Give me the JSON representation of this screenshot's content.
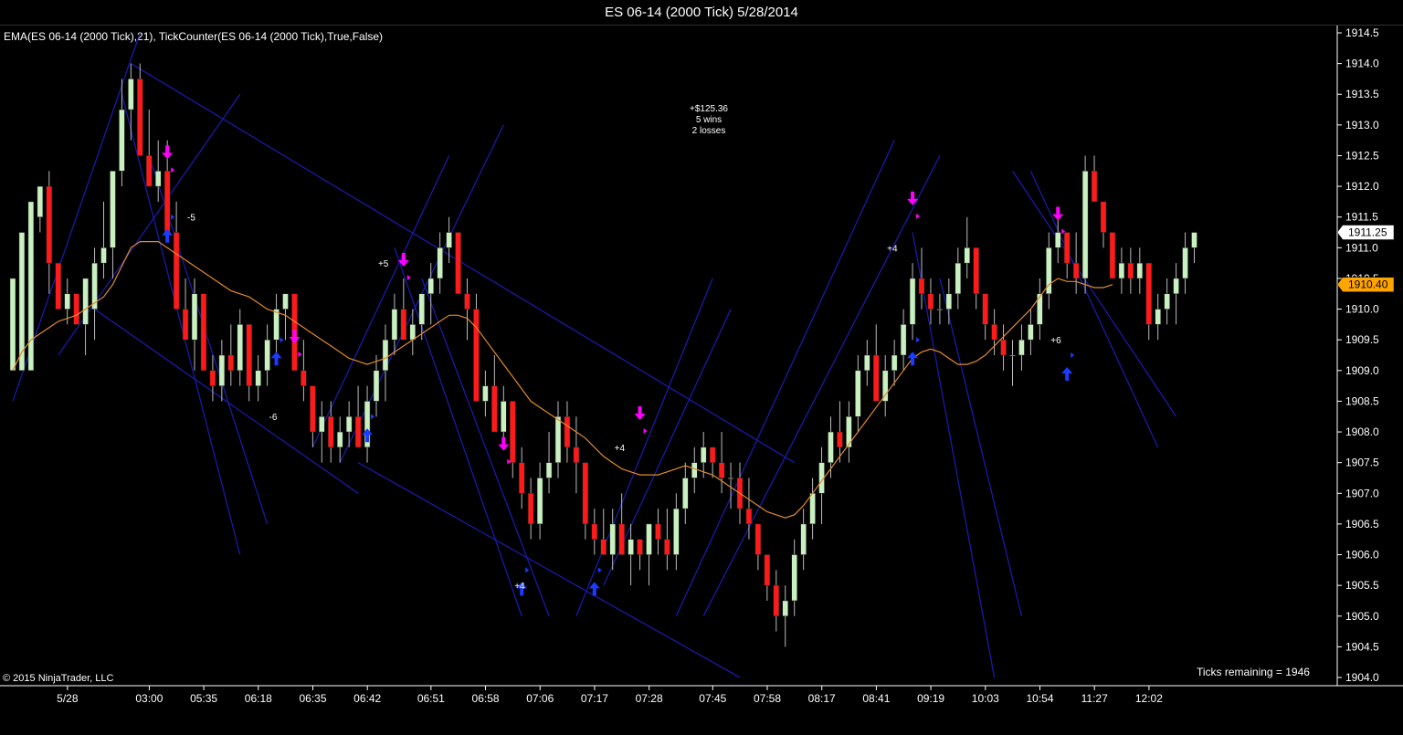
{
  "window": {
    "title": "ES 06-14 (2000 Tick)  5/28/2014"
  },
  "indicator_label": "EMA(ES 06-14 (2000 Tick),21),  TickCounter(ES 06-14 (2000 Tick),True,False)",
  "copyright": "© 2015 NinjaTrader, LLC",
  "ticks_remaining": "Ticks remaining = 1946",
  "strategy_stats": {
    "pnl": "+$125.36",
    "wins": "5 wins",
    "losses": "2 losses"
  },
  "colors": {
    "background": "#000000",
    "up_candle": "#c8f0c0",
    "down_candle": "#ff1a1a",
    "ema": "#e08a2a",
    "trendline": "#1a1aa8",
    "entry_short": "#ff00ff",
    "entry_long": "#1a3cff",
    "last_price_bg": "#ffffff",
    "ema_price_bg": "#ffa500"
  },
  "chart_data": {
    "type": "candlestick",
    "instrument": "ES 06-14",
    "bar_type": "2000 Tick",
    "ylim": [
      1904.0,
      1914.5
    ],
    "y_ticks": [
      "1904.0",
      "1904.5",
      "1905.0",
      "1905.5",
      "1906.0",
      "1906.5",
      "1907.0",
      "1907.5",
      "1908.0",
      "1908.5",
      "1909.0",
      "1909.5",
      "1910.0",
      "1910.5",
      "1911.0",
      "1911.5",
      "1912.0",
      "1912.5",
      "1913.0",
      "1913.5",
      "1914.0",
      "1914.5"
    ],
    "x_tick_labels": [
      "5/28",
      "03:00",
      "05:35",
      "06:18",
      "06:35",
      "06:42",
      "06:51",
      "06:58",
      "07:06",
      "07:17",
      "07:28",
      "07:45",
      "07:58",
      "08:17",
      "08:41",
      "09:19",
      "10:03",
      "10:54",
      "11:27",
      "12:02"
    ],
    "x_tick_bar_index": [
      3,
      12,
      18,
      24,
      30,
      36,
      43,
      49,
      55,
      61,
      67,
      74,
      80,
      86,
      92,
      98,
      104,
      110,
      116,
      122
    ],
    "last_price": "1911.25",
    "ema_price": "1910.40",
    "ohlc": [
      [
        1909.0,
        1910.5,
        1909.0,
        1910.5
      ],
      [
        1909.0,
        1909.0,
        1910.75,
        1911.25
      ],
      [
        1909.0,
        1909.0,
        1911.5,
        1911.75
      ],
      [
        1911.5,
        1911.75,
        1911.25,
        1912.0
      ],
      [
        1912.0,
        1912.25,
        1910.25,
        1910.75
      ],
      [
        1910.75,
        1910.75,
        1910.0,
        1910.0
      ],
      [
        1910.0,
        1910.5,
        1909.75,
        1910.25
      ],
      [
        1910.25,
        1910.25,
        1909.75,
        1909.75
      ],
      [
        1909.75,
        1910.5,
        1909.25,
        1910.5
      ],
      [
        1910.0,
        1911.0,
        1909.5,
        1910.75
      ],
      [
        1910.75,
        1911.75,
        1910.5,
        1911.0
      ],
      [
        1911.0,
        1912.25,
        1910.5,
        1912.25
      ],
      [
        1912.25,
        1913.75,
        1912.0,
        1913.25
      ],
      [
        1913.25,
        1914.0,
        1912.75,
        1913.75
      ],
      [
        1913.75,
        1914.0,
        1912.5,
        1912.5
      ],
      [
        1912.5,
        1913.25,
        1912.0,
        1912.0
      ],
      [
        1912.0,
        1912.75,
        1911.75,
        1912.25
      ],
      [
        1912.25,
        1912.75,
        1911.25,
        1911.25
      ],
      [
        1911.25,
        1911.75,
        1910.0,
        1910.0
      ],
      [
        1910.0,
        1910.5,
        1909.5,
        1909.5
      ],
      [
        1909.5,
        1910.5,
        1909.0,
        1910.25
      ],
      [
        1910.25,
        1910.25,
        1909.0,
        1909.0
      ],
      [
        1909.0,
        1909.25,
        1908.5,
        1908.75
      ],
      [
        1908.75,
        1909.5,
        1908.5,
        1909.25
      ],
      [
        1909.25,
        1909.75,
        1908.75,
        1909.0
      ],
      [
        1909.0,
        1910.0,
        1908.75,
        1909.75
      ],
      [
        1909.75,
        1909.75,
        1908.5,
        1908.75
      ],
      [
        1908.75,
        1909.25,
        1908.5,
        1909.0
      ],
      [
        1909.0,
        1909.75,
        1908.75,
        1909.5
      ],
      [
        1909.5,
        1910.25,
        1909.25,
        1910.0
      ],
      [
        1910.0,
        1910.25,
        1909.5,
        1910.25
      ],
      [
        1910.25,
        1910.25,
        1909.0,
        1909.0
      ],
      [
        1909.0,
        1909.5,
        1908.5,
        1908.75
      ],
      [
        1908.75,
        1908.75,
        1907.75,
        1908.0
      ],
      [
        1908.0,
        1908.5,
        1907.5,
        1908.25
      ],
      [
        1908.25,
        1908.5,
        1907.5,
        1907.75
      ],
      [
        1907.75,
        1908.25,
        1907.5,
        1908.0
      ],
      [
        1908.0,
        1908.5,
        1907.75,
        1908.25
      ],
      [
        1908.25,
        1908.75,
        1907.75,
        1907.75
      ],
      [
        1907.75,
        1908.75,
        1907.5,
        1908.5
      ],
      [
        1908.5,
        1909.25,
        1908.25,
        1909.0
      ],
      [
        1909.0,
        1909.75,
        1908.5,
        1909.5
      ],
      [
        1909.5,
        1910.25,
        1909.25,
        1910.0
      ],
      [
        1910.0,
        1910.5,
        1909.5,
        1909.5
      ],
      [
        1909.5,
        1910.0,
        1909.25,
        1909.75
      ],
      [
        1909.75,
        1910.25,
        1909.5,
        1910.25
      ],
      [
        1910.25,
        1910.75,
        1909.75,
        1910.5
      ],
      [
        1910.5,
        1911.25,
        1910.25,
        1911.0
      ],
      [
        1911.0,
        1911.5,
        1910.75,
        1911.25
      ],
      [
        1911.25,
        1911.25,
        1910.25,
        1910.25
      ],
      [
        1910.25,
        1910.5,
        1909.5,
        1910.0
      ],
      [
        1910.0,
        1910.25,
        1908.5,
        1908.5
      ],
      [
        1908.5,
        1909.0,
        1908.25,
        1908.75
      ],
      [
        1908.75,
        1909.25,
        1908.0,
        1908.0
      ],
      [
        1908.0,
        1908.75,
        1907.75,
        1908.5
      ],
      [
        1908.5,
        1908.5,
        1907.25,
        1907.5
      ],
      [
        1907.5,
        1907.75,
        1906.75,
        1907.0
      ],
      [
        1907.0,
        1907.25,
        1906.25,
        1906.5
      ],
      [
        1906.5,
        1907.5,
        1906.25,
        1907.25
      ],
      [
        1907.25,
        1908.0,
        1907.0,
        1907.5
      ],
      [
        1907.5,
        1908.5,
        1907.25,
        1908.25
      ],
      [
        1908.25,
        1908.5,
        1907.5,
        1907.75
      ],
      [
        1907.75,
        1908.25,
        1907.0,
        1907.5
      ],
      [
        1907.5,
        1907.5,
        1906.25,
        1906.5
      ],
      [
        1906.5,
        1906.75,
        1906.0,
        1906.25
      ],
      [
        1906.25,
        1906.75,
        1906.0,
        1906.0
      ],
      [
        1906.0,
        1906.75,
        1905.75,
        1906.5
      ],
      [
        1906.5,
        1907.0,
        1906.0,
        1906.0
      ],
      [
        1906.0,
        1906.5,
        1905.5,
        1906.25
      ],
      [
        1906.25,
        1906.25,
        1905.75,
        1906.0
      ],
      [
        1906.0,
        1906.5,
        1905.5,
        1906.5
      ],
      [
        1906.5,
        1906.75,
        1906.0,
        1906.25
      ],
      [
        1906.25,
        1906.75,
        1905.75,
        1906.0
      ],
      [
        1906.0,
        1907.0,
        1905.75,
        1906.75
      ],
      [
        1906.75,
        1907.5,
        1906.5,
        1907.25
      ]
    ],
    "ohlc_continued": [
      [
        1907.25,
        1907.75,
        1907.0,
        1907.5
      ],
      [
        1907.5,
        1908.0,
        1907.25,
        1907.75
      ],
      [
        1907.75,
        1907.75,
        1907.25,
        1907.5
      ],
      [
        1907.5,
        1908.0,
        1907.0,
        1907.25
      ],
      [
        1907.25,
        1907.5,
        1906.75,
        1907.25
      ],
      [
        1907.25,
        1907.5,
        1906.5,
        1906.75
      ],
      [
        1906.75,
        1907.25,
        1906.25,
        1906.5
      ],
      [
        1906.5,
        1906.5,
        1905.75,
        1906.0
      ],
      [
        1906.0,
        1906.0,
        1905.25,
        1905.5
      ],
      [
        1905.5,
        1905.75,
        1904.75,
        1905.0
      ],
      [
        1905.0,
        1905.5,
        1904.5,
        1905.25
      ],
      [
        1905.25,
        1906.25,
        1905.0,
        1906.0
      ],
      [
        1906.0,
        1906.75,
        1905.75,
        1906.5
      ],
      [
        1906.5,
        1907.25,
        1906.25,
        1907.0
      ],
      [
        1907.0,
        1907.75,
        1906.5,
        1907.5
      ],
      [
        1907.5,
        1908.25,
        1907.25,
        1908.0
      ],
      [
        1908.0,
        1908.5,
        1907.5,
        1907.75
      ],
      [
        1907.75,
        1908.5,
        1907.5,
        1908.25
      ],
      [
        1908.25,
        1909.25,
        1908.0,
        1909.0
      ],
      [
        1909.0,
        1909.5,
        1908.75,
        1909.25
      ],
      [
        1909.25,
        1909.75,
        1908.5,
        1908.5
      ],
      [
        1908.5,
        1909.25,
        1908.25,
        1909.0
      ],
      [
        1909.0,
        1909.5,
        1908.75,
        1909.25
      ],
      [
        1909.25,
        1910.0,
        1909.0,
        1909.75
      ],
      [
        1909.75,
        1910.75,
        1909.5,
        1910.5
      ],
      [
        1910.5,
        1911.0,
        1910.0,
        1910.25
      ],
      [
        1910.25,
        1910.5,
        1909.75,
        1910.0
      ],
      [
        1910.0,
        1910.25,
        1909.75,
        1910.0
      ],
      [
        1910.0,
        1910.5,
        1909.75,
        1910.25
      ],
      [
        1910.25,
        1911.0,
        1910.0,
        1910.75
      ],
      [
        1910.75,
        1911.5,
        1910.5,
        1911.0
      ],
      [
        1911.0,
        1911.0,
        1910.0,
        1910.25
      ],
      [
        1910.25,
        1910.25,
        1909.5,
        1909.75
      ],
      [
        1909.75,
        1910.0,
        1909.25,
        1909.5
      ],
      [
        1909.5,
        1909.75,
        1909.0,
        1909.25
      ],
      [
        1909.25,
        1909.5,
        1908.75,
        1909.25
      ],
      [
        1909.25,
        1909.75,
        1909.0,
        1909.5
      ],
      [
        1909.5,
        1910.0,
        1909.25,
        1909.75
      ],
      [
        1909.75,
        1910.5,
        1909.5,
        1910.25
      ],
      [
        1910.25,
        1911.25,
        1910.0,
        1911.0
      ],
      [
        1911.0,
        1911.5,
        1910.75,
        1911.25
      ],
      [
        1911.25,
        1911.25,
        1910.5,
        1910.75
      ],
      [
        1910.75,
        1911.25,
        1910.25,
        1910.5
      ],
      [
        1910.5,
        1912.5,
        1910.25,
        1912.25
      ],
      [
        1912.25,
        1912.5,
        1911.75,
        1911.75
      ],
      [
        1911.75,
        1911.75,
        1911.0,
        1911.25
      ],
      [
        1911.25,
        1911.25,
        1910.5,
        1910.5
      ],
      [
        1910.5,
        1911.0,
        1910.25,
        1910.75
      ],
      [
        1910.75,
        1911.0,
        1910.25,
        1910.5
      ],
      [
        1910.5,
        1911.0,
        1910.25,
        1910.75
      ],
      [
        1910.75,
        1910.75,
        1909.5,
        1909.75
      ],
      [
        1909.75,
        1910.25,
        1909.5,
        1910.0
      ],
      [
        1910.0,
        1910.5,
        1909.75,
        1910.25
      ],
      [
        1910.25,
        1910.75,
        1909.75,
        1910.5
      ],
      [
        1910.5,
        1911.25,
        1910.25,
        1911.0
      ],
      [
        1911.0,
        1911.25,
        1910.75,
        1911.25
      ]
    ],
    "ema_values": [
      1909.0,
      1909.3,
      1909.5,
      1909.6,
      1909.7,
      1909.8,
      1909.85,
      1909.9,
      1910.0,
      1910.1,
      1910.2,
      1910.4,
      1910.7,
      1911.0,
      1911.1,
      1911.1,
      1911.1,
      1911.0,
      1910.9,
      1910.8,
      1910.7,
      1910.6,
      1910.5,
      1910.4,
      1910.3,
      1910.25,
      1910.2,
      1910.1,
      1910.0,
      1909.95,
      1909.9,
      1909.8,
      1909.7,
      1909.6,
      1909.5,
      1909.4,
      1909.3,
      1909.2,
      1909.15,
      1909.1,
      1909.15,
      1909.2,
      1909.3,
      1909.4,
      1909.5,
      1909.6,
      1909.7,
      1909.8,
      1909.9,
      1909.9,
      1909.85,
      1909.7,
      1909.5,
      1909.3,
      1909.1,
      1908.9,
      1908.7,
      1908.5,
      1908.4,
      1908.3,
      1908.2,
      1908.1,
      1908.0,
      1907.9,
      1907.75,
      1907.6,
      1907.5,
      1907.4,
      1907.35,
      1907.3,
      1907.3,
      1907.3,
      1907.35,
      1907.4,
      1907.45,
      1907.4,
      1907.35,
      1907.3,
      1907.2,
      1907.1,
      1907.0,
      1906.9,
      1906.8,
      1906.7,
      1906.65,
      1906.6,
      1906.65,
      1906.8,
      1907.0,
      1907.2,
      1907.4,
      1907.6,
      1907.8,
      1908.0,
      1908.2,
      1908.4,
      1908.6,
      1908.8,
      1909.0,
      1909.2,
      1909.3,
      1909.35,
      1909.3,
      1909.2,
      1909.1,
      1909.1,
      1909.15,
      1909.25,
      1909.4,
      1909.55,
      1909.7,
      1909.85,
      1910.0,
      1910.2,
      1910.4,
      1910.5,
      1910.45,
      1910.45,
      1910.4,
      1910.35,
      1910.35,
      1910.4
    ]
  },
  "signals": [
    {
      "type": "short",
      "bar": 17,
      "price": 1912.25
    },
    {
      "type": "long",
      "bar": 17,
      "price": 1911.5
    },
    {
      "type": "long",
      "bar": 29,
      "price": 1909.5
    },
    {
      "type": "short",
      "bar": 31,
      "price": 1909.25
    },
    {
      "type": "long",
      "bar": 39,
      "price": 1908.25
    },
    {
      "type": "short",
      "bar": 43,
      "price": 1910.5
    },
    {
      "type": "short",
      "bar": 54,
      "price": 1907.5
    },
    {
      "type": "long",
      "bar": 56,
      "price": 1905.75
    },
    {
      "type": "long",
      "bar": 64,
      "price": 1905.75
    },
    {
      "type": "short",
      "bar": 69,
      "price": 1908.0
    },
    {
      "type": "short",
      "bar": 99,
      "price": 1911.5
    },
    {
      "type": "long",
      "bar": 99,
      "price": 1909.5
    },
    {
      "type": "short",
      "bar": 115,
      "price": 1911.25
    },
    {
      "type": "long",
      "bar": 116,
      "price": 1909.25
    }
  ],
  "trade_labels": [
    {
      "text": "-5",
      "bar": 20,
      "price": 1911.5
    },
    {
      "text": "-6",
      "bar": 29,
      "price": 1908.25
    },
    {
      "text": "+5",
      "bar": 41,
      "price": 1910.75
    },
    {
      "text": "+4",
      "bar": 56,
      "price": 1905.5
    },
    {
      "text": "+4",
      "bar": 67,
      "price": 1907.75
    },
    {
      "text": "+4",
      "bar": 97,
      "price": 1911.0
    },
    {
      "text": "+6",
      "bar": 115,
      "price": 1909.5
    }
  ],
  "trendlines": [
    {
      "from": [
        0,
        1908.5
      ],
      "to": [
        14,
        1914.5
      ]
    },
    {
      "from": [
        5,
        1909.25
      ],
      "to": [
        25,
        1913.5
      ]
    },
    {
      "from": [
        9,
        1910.0
      ],
      "to": [
        38,
        1907.0
      ]
    },
    {
      "from": [
        13,
        1914.0
      ],
      "to": [
        86,
        1907.5
      ]
    },
    {
      "from": [
        12,
        1913.5
      ],
      "to": [
        25,
        1906.0
      ]
    },
    {
      "from": [
        15,
        1912.5
      ],
      "to": [
        28,
        1906.5
      ]
    },
    {
      "from": [
        33,
        1907.75
      ],
      "to": [
        48,
        1912.5
      ]
    },
    {
      "from": [
        36,
        1907.5
      ],
      "to": [
        54,
        1913.0
      ]
    },
    {
      "from": [
        42,
        1911.0
      ],
      "to": [
        56,
        1905.0
      ]
    },
    {
      "from": [
        45,
        1910.5
      ],
      "to": [
        59,
        1905.0
      ]
    },
    {
      "from": [
        38,
        1907.5
      ],
      "to": [
        80,
        1904.0
      ]
    },
    {
      "from": [
        62,
        1905.0
      ],
      "to": [
        77,
        1910.5
      ]
    },
    {
      "from": [
        65,
        1905.5
      ],
      "to": [
        79,
        1910.0
      ]
    },
    {
      "from": [
        73,
        1905.0
      ],
      "to": [
        97,
        1912.75
      ]
    },
    {
      "from": [
        76,
        1905.0
      ],
      "to": [
        102,
        1912.5
      ]
    },
    {
      "from": [
        99,
        1911.25
      ],
      "to": [
        108,
        1904.0
      ]
    },
    {
      "from": [
        102,
        1910.5
      ],
      "to": [
        111,
        1905.0
      ]
    },
    {
      "from": [
        110,
        1912.25
      ],
      "to": [
        128,
        1908.25
      ]
    },
    {
      "from": [
        112,
        1912.25
      ],
      "to": [
        126,
        1907.75
      ]
    }
  ]
}
